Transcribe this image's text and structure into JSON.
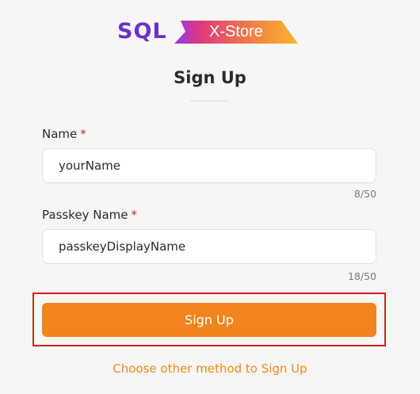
{
  "logo": {
    "primary_text": "SQL",
    "secondary_text": "X-Store",
    "colors": {
      "primary": "#6a32c9",
      "gradient_start": "#8a3cf0",
      "gradient_mid": "#e0377f",
      "gradient_end": "#f7b731"
    }
  },
  "page": {
    "title": "Sign Up"
  },
  "form": {
    "name": {
      "label": "Name",
      "required_mark": "*",
      "value": "yourName",
      "counter": "8/50"
    },
    "passkey_name": {
      "label": "Passkey Name",
      "required_mark": "*",
      "value": "passkeyDisplayName",
      "counter": "18/50"
    },
    "submit_label": "Sign Up",
    "alt_method_label": "Choose other method to Sign Up"
  },
  "colors": {
    "accent": "#f2841e",
    "link": "#ee8a1c",
    "required": "#c62828",
    "highlight_border": "#d21f1f"
  }
}
